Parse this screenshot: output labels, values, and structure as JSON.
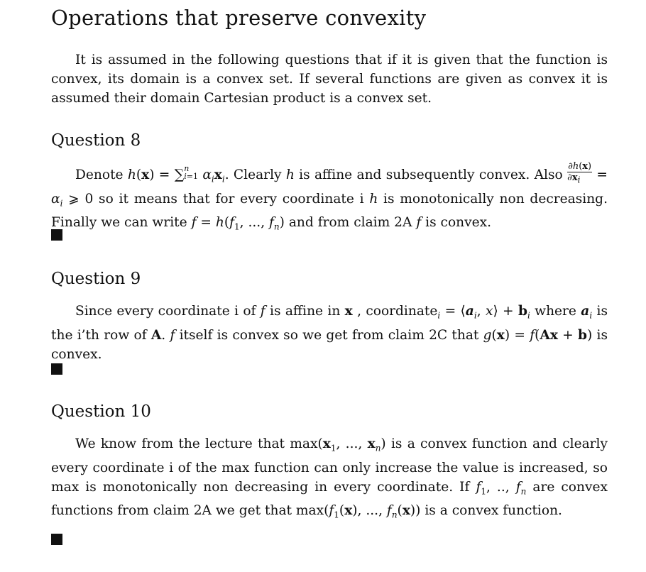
{
  "section": {
    "title": "Operations that preserve convexity",
    "intro": "It is assumed in the following questions that if it is given that the function is convex, its domain is a convex set. If several functions are given as convex it is assumed their domain Cartesian product is a convex set."
  },
  "q8": {
    "heading": "Question 8",
    "t1": "Denote ",
    "t2": ". Clearly ",
    "t3": " is affine and subsequently convex. Also",
    "t4": " so it means that for every coordinate i ",
    "t5": " is monotonically non decreasing. Finally we can write ",
    "t6": " and from claim 2A ",
    "t7": " is convex."
  },
  "q9": {
    "heading": "Question 9",
    "t1": "Since every coordinate i of ",
    "t2": " is affine in ",
    "t3": " , coordinate",
    "t4": " where ",
    "t5": " is the i’th row of ",
    "t6": ". ",
    "t7": " itself is convex so we get from claim 2C that ",
    "t8": " is convex."
  },
  "q10": {
    "heading": "Question 10",
    "t1": "We know from the lecture that max(",
    "t2": ") is a convex function and clearly every coordinate i of the max function can only increase the value is increased, so max is monotonically non decreasing in every coordinate. If ",
    "t3": " are convex functions from claim 2A we get that max(",
    "t4": ") is a convex function."
  }
}
